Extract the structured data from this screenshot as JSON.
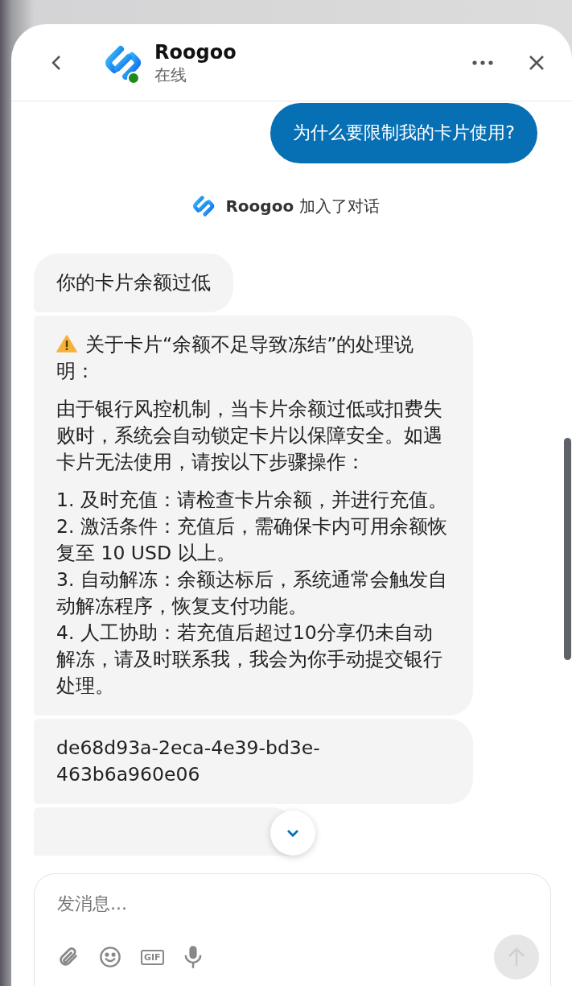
{
  "header": {
    "title": "Roogoo",
    "status": "在线",
    "online": true
  },
  "messages": [
    {
      "kind": "outgoing",
      "text": "为什么要限制我的卡片使用?"
    },
    {
      "kind": "system",
      "name": "Roogoo",
      "text": "加入了对话"
    },
    {
      "kind": "incoming",
      "paragraphs": [
        "你的卡片余额过低"
      ]
    },
    {
      "kind": "incoming",
      "warning": true,
      "paragraphs": [
        "关于卡片“余额不足导致冻结”的处理说明：",
        "由于银行风控机制，当卡片余额过低或扣费失败时，系统会自动锁定卡片以保障安全。如遇卡片无法使用，请按以下步骤操作："
      ],
      "steps": [
        "1. 及时充值：请检查卡片余额，并进行充值。",
        "2. 激活条件：充值后，需确保卡内可用余额恢复至 10 USD 以上。",
        "3. 自动解冻：余额达标后，系统通常会触发自动解冻程序，恢复支付功能。",
        "4. 人工协助：若充值后超过10分享仍未自动解冻，请及时联系我，我会为你手动提交银行处理。"
      ]
    },
    {
      "kind": "incoming",
      "paragraphs": [
        "de68d93a-2eca-4e39-bd3e-463b6a960e06"
      ]
    },
    {
      "kind": "partial"
    }
  ],
  "composer": {
    "placeholder": "发消息...",
    "gif_label": "GIF",
    "send_disabled": true
  }
}
